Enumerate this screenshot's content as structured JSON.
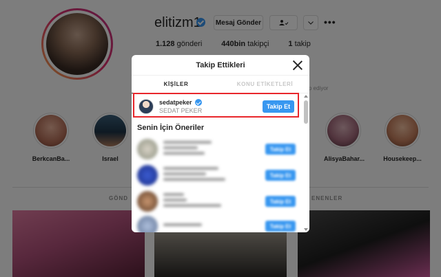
{
  "profile": {
    "username": "elitizm1",
    "message_button": "Mesaj Gönder",
    "follow_icon": "person-check-icon",
    "more_icon": "more-dots-icon",
    "stats": [
      {
        "value": "1.128",
        "label": "gönderi"
      },
      {
        "value": "440bin",
        "label": "takipçi"
      },
      {
        "value": "1",
        "label": "takip"
      }
    ],
    "followed_by_fragment": "p ediyor"
  },
  "highlights": [
    {
      "label": "BerkcanBa..."
    },
    {
      "label": "Israel"
    },
    {
      "label": ""
    },
    {
      "label": ""
    },
    {
      "label": ""
    },
    {
      "label": ""
    },
    {
      "label": "AlisyaBahar..."
    },
    {
      "label": "Housekeep..."
    }
  ],
  "profile_tabs": {
    "left": "GÖND",
    "right": "ENENLER"
  },
  "modal": {
    "title": "Takip Ettikleri",
    "close_icon": "close-icon",
    "tabs": [
      {
        "label": "KİŞİLER",
        "active": true
      },
      {
        "label": "KONU ETİKETLERİ",
        "active": false
      }
    ],
    "following": [
      {
        "username": "sedatpeker",
        "full_name": "SEDAT PEKER",
        "verified": true,
        "button": "Takip Et"
      }
    ],
    "suggestions_title": "Senin İçin Öneriler",
    "suggestions_button": "Takip Et",
    "accent_color": "#3897f0",
    "highlight_color": "#e8262b"
  }
}
